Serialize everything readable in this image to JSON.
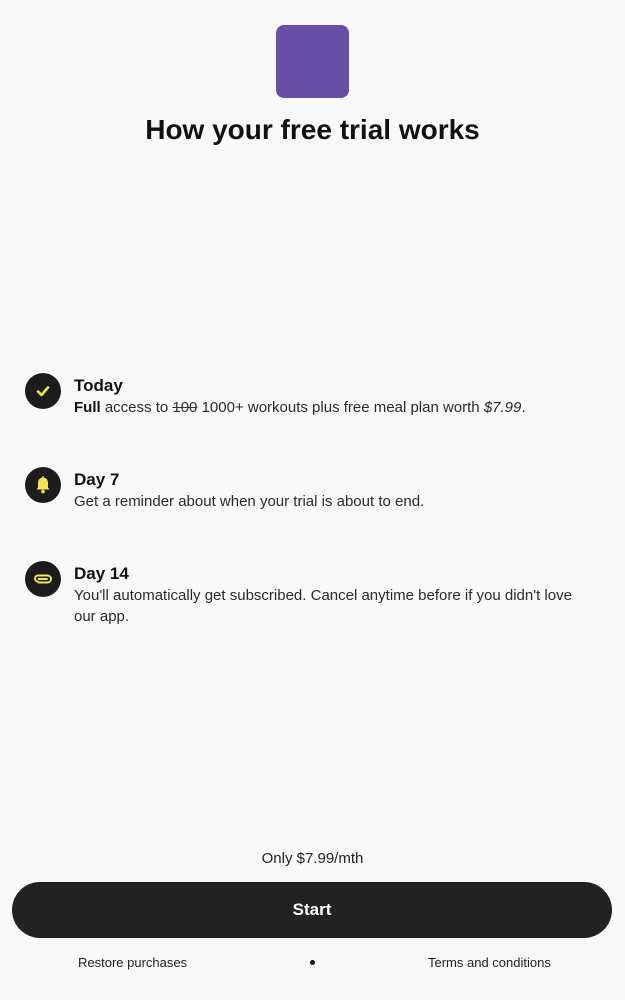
{
  "header": {
    "app_icon_color": "#6a4fa6",
    "title": "How your free trial works"
  },
  "steps": [
    {
      "icon": "check-icon",
      "title": "Today",
      "desc_bold": "Full",
      "desc_part1": " access to ",
      "desc_strike": "100",
      "desc_part2": " 1000+ workouts plus free meal plan worth ",
      "desc_price": "$7.99",
      "desc_end": "."
    },
    {
      "icon": "bell-icon",
      "title": "Day 7",
      "description": "Get a reminder about when your trial is about to end."
    },
    {
      "icon": "paperclip-icon",
      "title": "Day 14",
      "description": "You'll automatically get subscribed. Cancel anytime before if you didn't love our app."
    }
  ],
  "pricing": {
    "note": "Only $7.99/mth"
  },
  "cta": {
    "start_label": "Start"
  },
  "footer": {
    "restore_label": "Restore purchases",
    "terms_label": "Terms and conditions"
  },
  "colors": {
    "icon_accent": "#f5e35c",
    "button_bg": "#222222"
  }
}
